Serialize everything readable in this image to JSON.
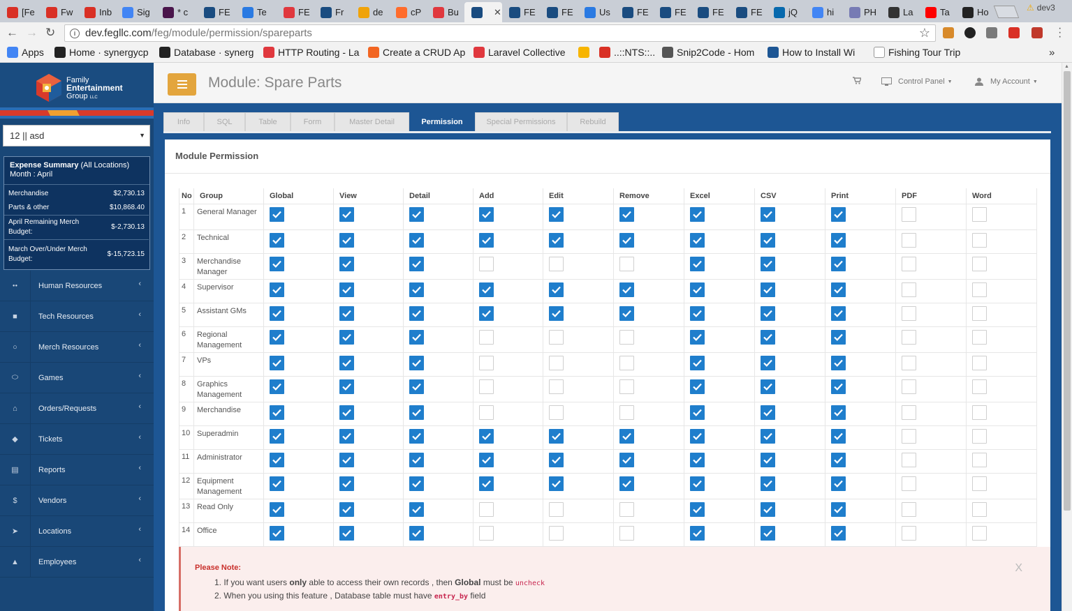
{
  "browser": {
    "tabs": [
      {
        "label": "[Fe",
        "icon": "gmail-icon",
        "color": "#d93025"
      },
      {
        "label": "Fw",
        "icon": "gmail-icon",
        "color": "#d93025"
      },
      {
        "label": "Inb",
        "icon": "gmail-icon",
        "color": "#d93025"
      },
      {
        "label": "Sig",
        "icon": "google-icon",
        "color": "#4285f4"
      },
      {
        "label": "* c",
        "icon": "slack-icon",
        "color": "#4a154b"
      },
      {
        "label": "FE",
        "icon": "feg-icon",
        "color": "#1a4c80"
      },
      {
        "label": "Te",
        "icon": "doc-icon",
        "color": "#2a7ae2"
      },
      {
        "label": "FE",
        "icon": "laravel-icon",
        "color": "#e0383e"
      },
      {
        "label": "Fr",
        "icon": "feg-icon",
        "color": "#1a4c80"
      },
      {
        "label": "de",
        "icon": "pma-icon",
        "color": "#f0a30a"
      },
      {
        "label": "cP",
        "icon": "cpanel-icon",
        "color": "#ff6c2c"
      },
      {
        "label": "Bu",
        "icon": "laravel-icon",
        "color": "#e0383e"
      },
      {
        "label": "",
        "icon": "feg-icon",
        "color": "#1a4c80"
      },
      {
        "label": "FE",
        "icon": "feg-icon",
        "color": "#1a4c80"
      },
      {
        "label": "FE",
        "icon": "feg-icon",
        "color": "#1a4c80"
      },
      {
        "label": "Us",
        "icon": "doc-icon",
        "color": "#2a7ae2"
      },
      {
        "label": "FE",
        "icon": "feg-icon",
        "color": "#1a4c80"
      },
      {
        "label": "FE",
        "icon": "feg-icon",
        "color": "#1a4c80"
      },
      {
        "label": "FE",
        "icon": "feg-icon",
        "color": "#1a4c80"
      },
      {
        "label": "FE",
        "icon": "feg-icon",
        "color": "#1a4c80"
      },
      {
        "label": "jQ",
        "icon": "jquery-icon",
        "color": "#0769ad"
      },
      {
        "label": "hi",
        "icon": "google-icon",
        "color": "#4285f4"
      },
      {
        "label": "PH",
        "icon": "php-icon",
        "color": "#777bb4"
      },
      {
        "label": "La",
        "icon": "bookmark-icon",
        "color": "#333333"
      },
      {
        "label": "Ta",
        "icon": "youtube-icon",
        "color": "#ff0000"
      },
      {
        "label": "Ho",
        "icon": "github-icon",
        "color": "#222222"
      }
    ],
    "profile": "dev3",
    "url_host": "dev.fegllc.com",
    "url_path": "/feg/module/permission/spareparts",
    "bookmarks": [
      {
        "label": "Apps",
        "icon": "apps-icon",
        "color": "#4285f4"
      },
      {
        "label": "Home · synergycp",
        "icon": "github-icon",
        "color": "#222222"
      },
      {
        "label": "Database · synerg",
        "icon": "github-icon",
        "color": "#222222"
      },
      {
        "label": "HTTP Routing - La",
        "icon": "laravel-icon",
        "color": "#e0383e"
      },
      {
        "label": "Create a CRUD Ap",
        "icon": "doc-icon",
        "color": "#f26522"
      },
      {
        "label": "Laravel Collective",
        "icon": "laravel-icon",
        "color": "#e0383e"
      },
      {
        "label": "",
        "icon": "sketch-icon",
        "color": "#f7b500"
      },
      {
        "label": "..::NTS::..",
        "icon": "nts-icon",
        "color": "#d93025"
      },
      {
        "label": "Snip2Code - Hom",
        "icon": "snip-icon",
        "color": "#555555"
      },
      {
        "label": "How to Install Wi",
        "icon": "h-icon",
        "color": "#1d5694"
      },
      {
        "label": "Fishing Tour Trip",
        "icon": "fish-icon",
        "color": "#ffffff"
      }
    ]
  },
  "app": {
    "brand": {
      "line1": "Family",
      "line2": "Entertainment",
      "line3": "Group",
      "suffix": "LLC"
    },
    "location_select": "12 || asd",
    "expense": {
      "title": "Expense Summary",
      "title_suffix": "(All Locations)",
      "month": "Month : April",
      "rows": [
        {
          "label": "Merchandise",
          "value": "$2,730.13"
        },
        {
          "label": "Parts & other",
          "value": "$10,868.40"
        },
        {
          "label": "April Remaining Merch Budget:",
          "value": "$-2,730.13"
        },
        {
          "label": "March Over/Under Merch Budget:",
          "value": "$-15,723.15"
        }
      ]
    },
    "menu": [
      {
        "label": "Human Resources",
        "icon": "users-icon"
      },
      {
        "label": "Tech Resources",
        "icon": "folder-icon"
      },
      {
        "label": "Merch Resources",
        "icon": "circle-icon"
      },
      {
        "label": "Games",
        "icon": "gamepad-icon"
      },
      {
        "label": "Orders/Requests",
        "icon": "cart-icon"
      },
      {
        "label": "Tickets",
        "icon": "ticket-icon"
      },
      {
        "label": "Reports",
        "icon": "document-icon"
      },
      {
        "label": "Vendors",
        "icon": "dollar-icon"
      },
      {
        "label": "Locations",
        "icon": "location-arrow-icon"
      },
      {
        "label": "Employees",
        "icon": "user-icon"
      }
    ],
    "page_title": "Module: Spare Parts",
    "control_panel": "Control Panel",
    "my_account": "My Account",
    "tabs": [
      "Info",
      "SQL",
      "Table",
      "Form",
      "Master Detail",
      "Permission",
      "Special Permissions",
      "Rebuild"
    ],
    "active_tab": "Permission",
    "panel_title": "Module Permission",
    "columns": [
      "No",
      "Group",
      "Global",
      "View",
      "Detail",
      "Add",
      "Edit",
      "Remove",
      "Excel",
      "CSV",
      "Print",
      "PDF",
      "Word"
    ],
    "rows": [
      {
        "no": "1",
        "group": "General Manager",
        "perms": [
          1,
          1,
          1,
          1,
          1,
          1,
          1,
          1,
          1,
          0,
          0
        ]
      },
      {
        "no": "2",
        "group": "Technical",
        "perms": [
          1,
          1,
          1,
          1,
          1,
          1,
          1,
          1,
          1,
          0,
          0
        ]
      },
      {
        "no": "3",
        "group": "Merchandise Manager",
        "perms": [
          1,
          1,
          1,
          0,
          0,
          0,
          1,
          1,
          1,
          0,
          0
        ]
      },
      {
        "no": "4",
        "group": "Supervisor",
        "perms": [
          1,
          1,
          1,
          1,
          1,
          1,
          1,
          1,
          1,
          0,
          0
        ]
      },
      {
        "no": "5",
        "group": "Assistant GMs",
        "perms": [
          1,
          1,
          1,
          1,
          1,
          1,
          1,
          1,
          1,
          0,
          0
        ]
      },
      {
        "no": "6",
        "group": "Regional Management",
        "perms": [
          1,
          1,
          1,
          0,
          0,
          0,
          1,
          1,
          1,
          0,
          0
        ]
      },
      {
        "no": "7",
        "group": "VPs",
        "perms": [
          1,
          1,
          1,
          0,
          0,
          0,
          1,
          1,
          1,
          0,
          0
        ]
      },
      {
        "no": "8",
        "group": "Graphics Management",
        "perms": [
          1,
          1,
          1,
          0,
          0,
          0,
          1,
          1,
          1,
          0,
          0
        ]
      },
      {
        "no": "9",
        "group": "Merchandise",
        "perms": [
          1,
          1,
          1,
          0,
          0,
          0,
          1,
          1,
          1,
          0,
          0
        ]
      },
      {
        "no": "10",
        "group": "Superadmin",
        "perms": [
          1,
          1,
          1,
          1,
          1,
          1,
          1,
          1,
          1,
          0,
          0
        ]
      },
      {
        "no": "11",
        "group": "Administrator",
        "perms": [
          1,
          1,
          1,
          1,
          1,
          1,
          1,
          1,
          1,
          0,
          0
        ]
      },
      {
        "no": "12",
        "group": "Equipment Management",
        "perms": [
          1,
          1,
          1,
          1,
          1,
          1,
          1,
          1,
          1,
          0,
          0
        ]
      },
      {
        "no": "13",
        "group": "Read Only",
        "perms": [
          1,
          1,
          1,
          0,
          0,
          0,
          1,
          1,
          1,
          0,
          0
        ]
      },
      {
        "no": "14",
        "group": "Office",
        "perms": [
          1,
          1,
          1,
          0,
          0,
          0,
          1,
          1,
          1,
          0,
          0
        ]
      }
    ],
    "note": {
      "title": "Please Note:",
      "line1_a": "1. If you want users ",
      "line1_b": "only",
      "line1_c": " able to access their own records , then ",
      "line1_d": "Global",
      "line1_e": " must be ",
      "line1_code": "uncheck",
      "line2_a": "2. When you using this feature , Database table must have ",
      "line2_code": "entry_by",
      "line2_b": " field",
      "close": "X"
    },
    "colors": {
      "accent": "#e3a53d",
      "sidebar": "#194777",
      "band": "#1d5694",
      "check": "#1f7ecc"
    }
  }
}
